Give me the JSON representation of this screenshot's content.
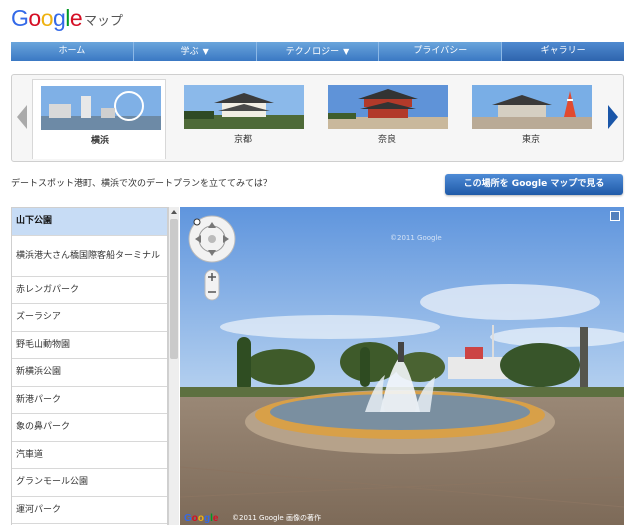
{
  "header": {
    "logo_letters": [
      {
        "ch": "G",
        "color": "#3369e8"
      },
      {
        "ch": "o",
        "color": "#d50f25"
      },
      {
        "ch": "o",
        "color": "#eeb211"
      },
      {
        "ch": "g",
        "color": "#3369e8"
      },
      {
        "ch": "l",
        "color": "#009925"
      },
      {
        "ch": "e",
        "color": "#d50f25"
      }
    ],
    "subtitle": "マップ"
  },
  "nav": {
    "items": [
      {
        "label": "ホーム",
        "has_caret": false
      },
      {
        "label": "学ぶ",
        "has_caret": true
      },
      {
        "label": "テクノロジー",
        "has_caret": true
      },
      {
        "label": "プライバシー",
        "has_caret": false
      },
      {
        "label": "ギャラリー",
        "has_caret": false
      }
    ],
    "caret_glyph": "▼"
  },
  "gallery": {
    "items": [
      {
        "caption": "横浜",
        "selected": true,
        "icon": "yokohama-thumbnail"
      },
      {
        "caption": "京都",
        "selected": false,
        "icon": "kyoto-thumbnail"
      },
      {
        "caption": "奈良",
        "selected": false,
        "icon": "nara-thumbnail"
      },
      {
        "caption": "東京",
        "selected": false,
        "icon": "tokyo-thumbnail"
      }
    ],
    "arrow_color_left": "#aaaaaa",
    "arrow_color_right": "#1a56a8"
  },
  "description": "デートスポット港町、横浜で次のデートプランを立ててみては？",
  "cta_label": "この場所を Google マップで見る",
  "places": [
    "山下公園",
    "横浜港大さん橋国際客船ターミナル",
    "赤レンガパーク",
    "ズーラシア",
    "野毛山動物園",
    "新横浜公園",
    "新港パーク",
    "象の鼻パーク",
    "汽車道",
    "グランモール公園",
    "運河パーク"
  ],
  "active_place_index": 0,
  "streetview": {
    "footer_logo": "Google",
    "footer_text": "©2011 Google    画像の著作",
    "watermark": "©2011 Google"
  }
}
